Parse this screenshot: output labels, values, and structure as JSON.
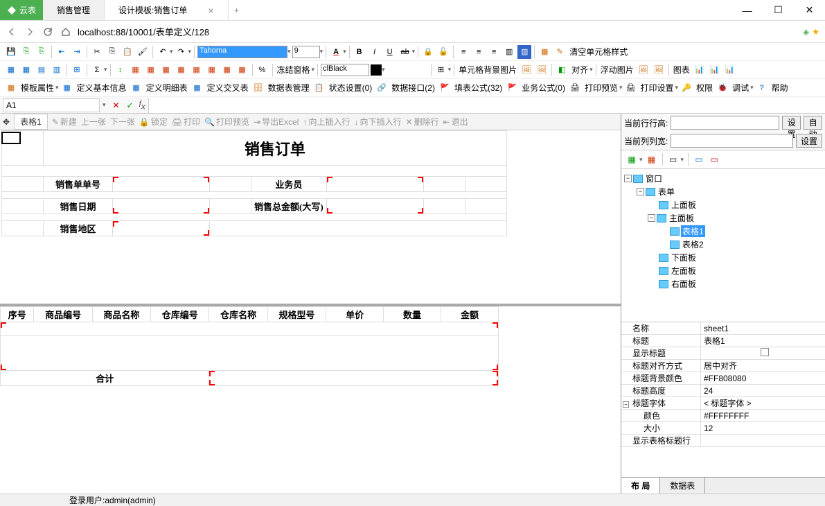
{
  "app": {
    "name": "云表"
  },
  "tabs": {
    "main": "销售管理",
    "active": "设计模板:销售订单"
  },
  "url": "localhost:88/10001/表单定义/128",
  "toolbar1": {
    "font": "Tahoma",
    "size": "9",
    "color": "clBlack",
    "clear_style": "清空单元格样式"
  },
  "toolbar2": {
    "freeze": "冻结窗格",
    "cellbg": "单元格背景图片",
    "align": "对齐",
    "float": "浮动图片",
    "chart": "图表"
  },
  "toolbar3": {
    "tpl_prop": "模板属性",
    "basic": "定义基本信息",
    "detail": "定义明细表",
    "cross": "定义交叉表",
    "dbmgr": "数据表管理",
    "status": "状态设置(0)",
    "api": "数据接口(2)",
    "fill": "填表公式(32)",
    "biz": "业务公式(0)",
    "preview": "打印预览",
    "print": "打印设置",
    "perm": "权限",
    "debug": "调试",
    "help": "帮助"
  },
  "cell": {
    "ref": "A1"
  },
  "subbar": {
    "grid": "表格1",
    "new": "新建",
    "prev": "上一张",
    "next": "下一张",
    "lock": "锁定",
    "print": "打印",
    "preview": "打印预览",
    "excel": "导出Excel",
    "insup": "向上插入行",
    "insdn": "向下插入行",
    "delrow": "删除行",
    "exit": "退出"
  },
  "form": {
    "title": "销售订单",
    "labels": {
      "order_no": "销售单单号",
      "sales": "业务员",
      "date": "销售日期",
      "amount_cn": "销售总金额(大写)",
      "region": "销售地区"
    }
  },
  "detail": {
    "headers": [
      "序号",
      "商品编号",
      "商品名称",
      "仓库编号",
      "仓库名称",
      "规格型号",
      "单价",
      "数量",
      "金额"
    ],
    "total": "合计"
  },
  "right": {
    "row_h": "当前行行高:",
    "col_w": "当前列列宽:",
    "set": "设置",
    "auto": "自动"
  },
  "tree": {
    "window": "窗口",
    "form": "表单",
    "top": "上面板",
    "main": "主面板",
    "g1": "表格1",
    "g2": "表格2",
    "bottom": "下面板",
    "left": "左面板",
    "right": "右面板"
  },
  "props": [
    {
      "k": "名称",
      "v": "sheet1"
    },
    {
      "k": "标题",
      "v": "表格1"
    },
    {
      "k": "显示标题",
      "v": "",
      "chk": true
    },
    {
      "k": "标题对齐方式",
      "v": "居中对齐"
    },
    {
      "k": "标题背景颜色",
      "v": "#FF808080"
    },
    {
      "k": "标题高度",
      "v": "24"
    },
    {
      "k": "标题字体",
      "v": "< 标题字体 >",
      "exp": true
    },
    {
      "k": "颜色",
      "v": "#FFFFFFFF",
      "indent": true
    },
    {
      "k": "大小",
      "v": "12",
      "indent": true
    },
    {
      "k": "显示表格标题行",
      "v": ""
    }
  ],
  "rtabs": {
    "layout": "布 局",
    "data": "数据表"
  },
  "status": "登录用户:admin(admin)"
}
